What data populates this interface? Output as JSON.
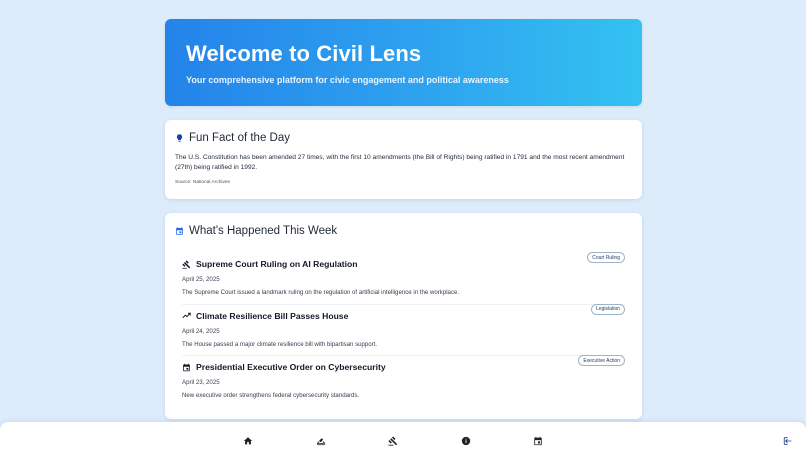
{
  "hero": {
    "title": "Welcome to Civil Lens",
    "subtitle": "Your comprehensive platform for civic engagement and political awareness"
  },
  "fun_fact": {
    "icon": "lightbulb-icon",
    "title": "Fun Fact of the Day",
    "text": "The U.S. Constitution has been amended 27 times, with the first 10 amendments (the Bill of Rights) being ratified in 1791 and the most recent amendment (27th) being ratified in 1992.",
    "source": "Source: National Archives"
  },
  "week": {
    "icon": "calendar-icon",
    "title": "What's Happened This Week",
    "events": [
      {
        "icon": "gavel-icon",
        "title": "Supreme Court Ruling on AI Regulation",
        "date": "April 25, 2025",
        "description": "The Supreme Court issued a landmark ruling on the regulation of artificial intelligence in the workplace.",
        "badge": "Court Ruling"
      },
      {
        "icon": "trending-up-icon",
        "title": "Climate Resilience Bill Passes House",
        "date": "April 24, 2025",
        "description": "The House passed a major climate resilience bill with bipartisan support.",
        "badge": "Legislation"
      },
      {
        "icon": "calendar-event-icon",
        "title": "Presidential Executive Order on Cybersecurity",
        "date": "April 23, 2025",
        "description": "New executive order strengthens federal cybersecurity standards.",
        "badge": "Executive Action"
      }
    ]
  },
  "bottom_nav": {
    "items": [
      "home-icon",
      "vote-icon",
      "gavel-icon",
      "info-icon",
      "calendar-icon"
    ],
    "logout": "logout-icon"
  },
  "colors": {
    "background": "#dcecfb",
    "hero_gradient_start": "#2483ea",
    "hero_gradient_end": "#33c2f1",
    "accent_blue": "#2563eb",
    "text_dark": "#1f2937"
  }
}
